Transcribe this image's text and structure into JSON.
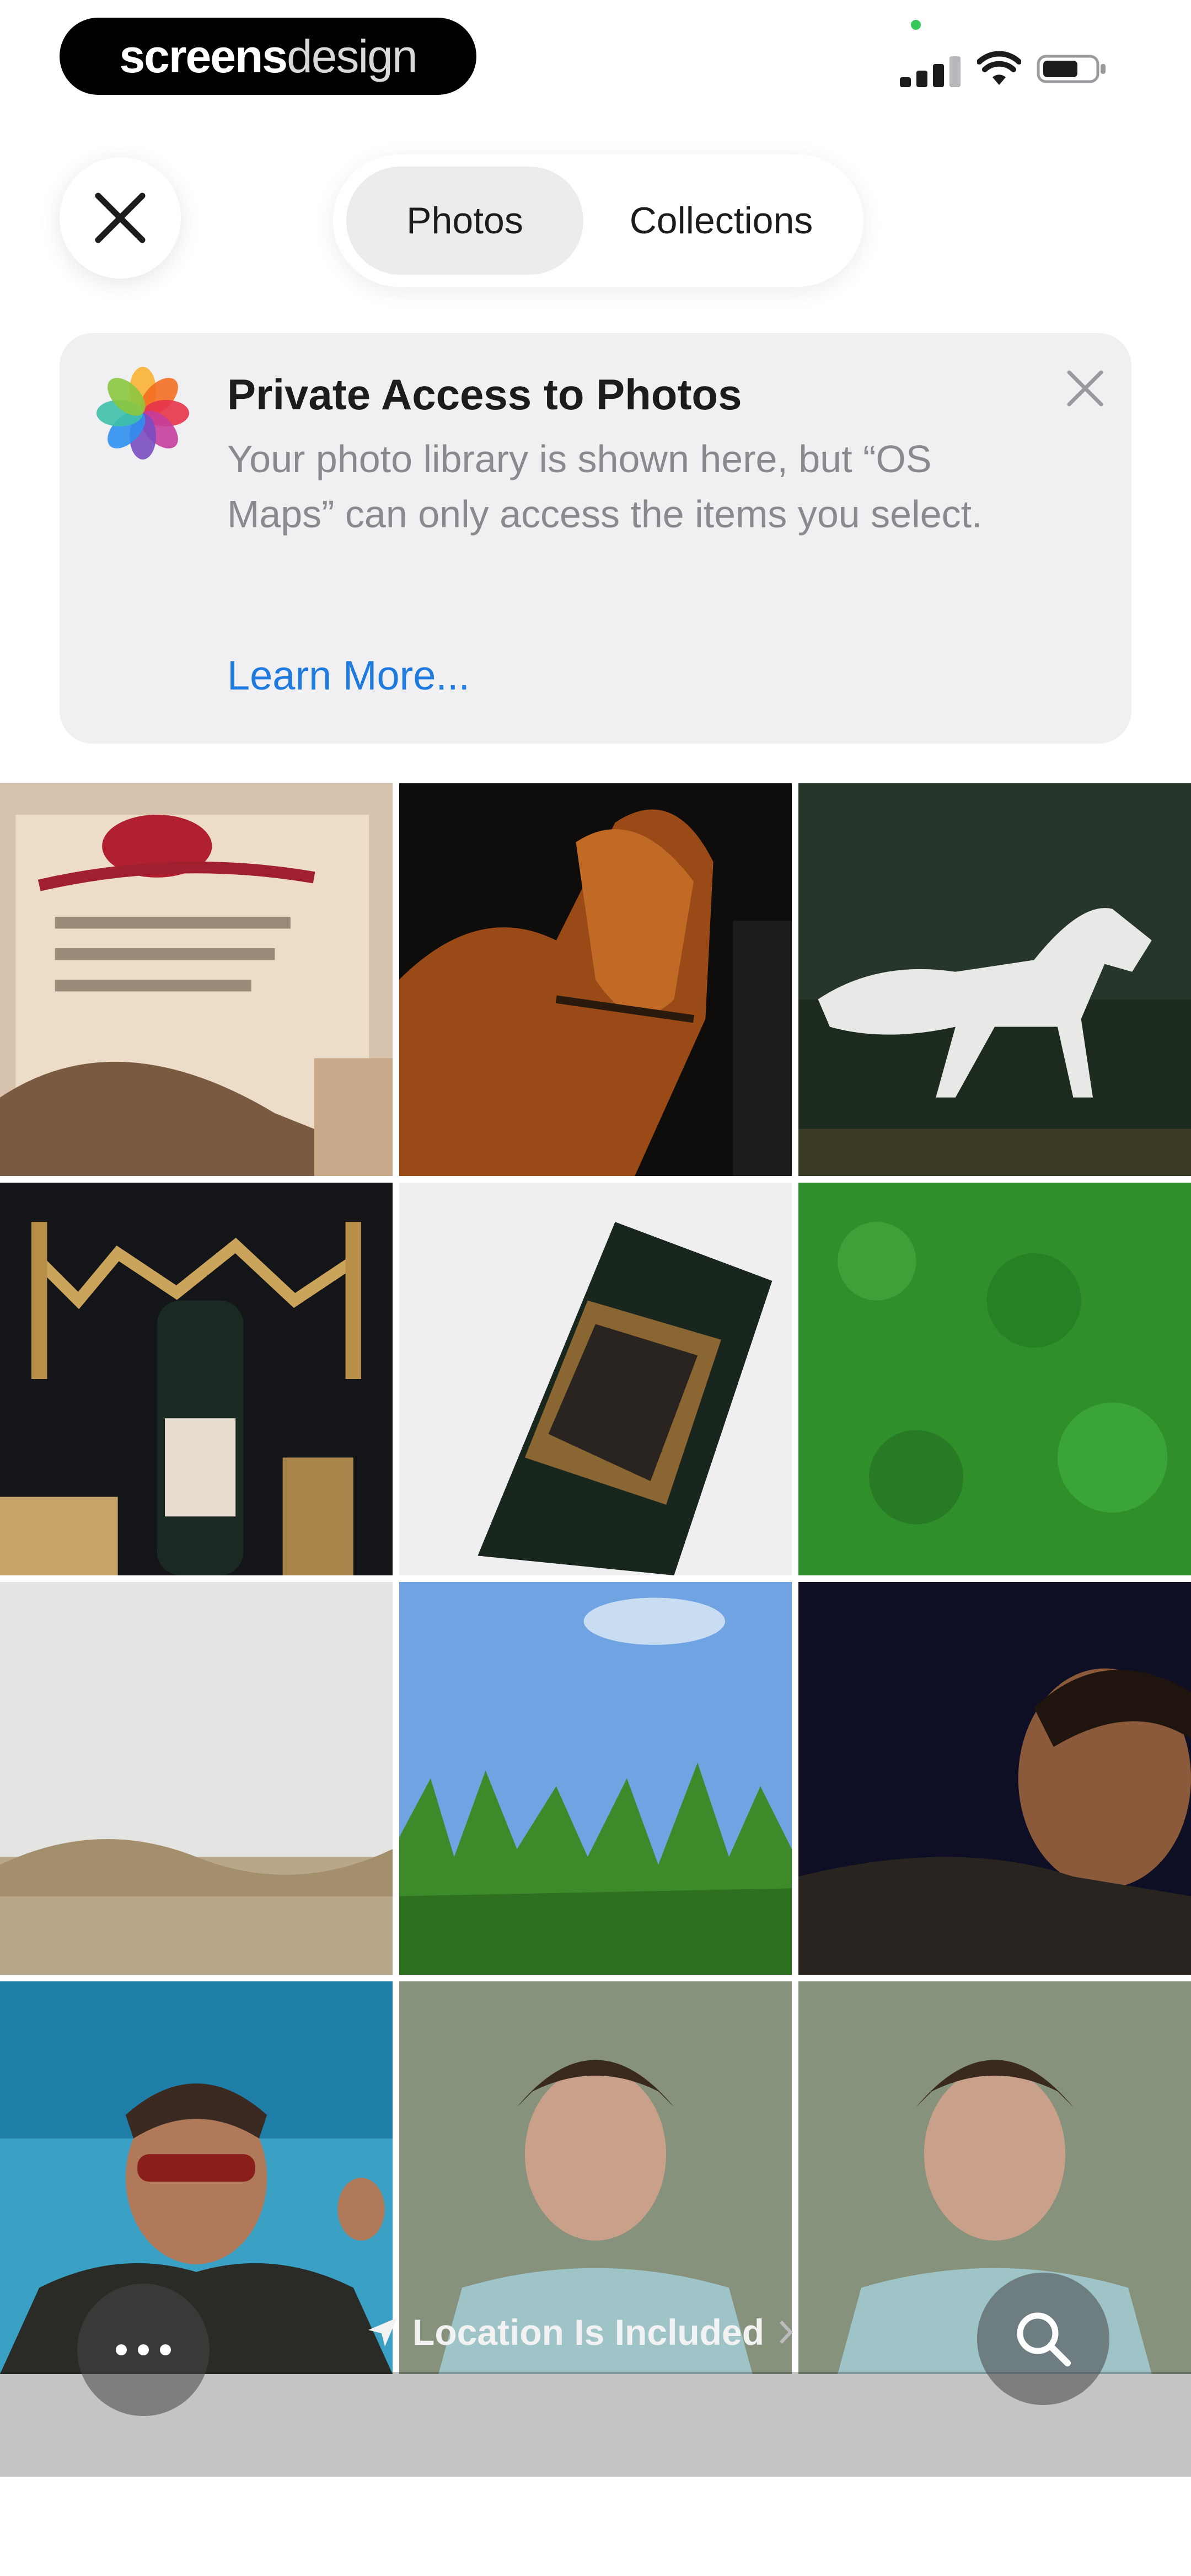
{
  "status_bar": {
    "brand_bold": "screens",
    "brand_light": "design"
  },
  "segmented_control": {
    "tabs": [
      {
        "label": "Photos",
        "selected": true
      },
      {
        "label": "Collections",
        "selected": false
      }
    ]
  },
  "banner": {
    "title": "Private Access to Photos",
    "body": "Your photo library is shown here, but “OS Maps” can only access the items you select.",
    "link": "Learn More..."
  },
  "grid": {
    "photos": [
      {
        "name": "certificate-photo"
      },
      {
        "name": "brown-horse-photo"
      },
      {
        "name": "white-horse-photo"
      },
      {
        "name": "wine-bottles-photo"
      },
      {
        "name": "green-bottle-photo"
      },
      {
        "name": "green-grass-photo"
      },
      {
        "name": "misty-field-photo"
      },
      {
        "name": "cornfield-sky-photo"
      },
      {
        "name": "smiling-man-dark-photo"
      },
      {
        "name": "man-sunglasses-photo"
      },
      {
        "name": "young-man-portrait-photo"
      },
      {
        "name": "young-man-portrait-2-photo"
      }
    ]
  },
  "toolbar": {
    "location_label": "Location Is Included",
    "more_icon": "ellipsis-icon",
    "search_icon": "search-icon"
  },
  "colors": {
    "link_blue": "#1f7ae0",
    "banner_bg": "#f0f0f2",
    "active_segment": "#ececee"
  }
}
